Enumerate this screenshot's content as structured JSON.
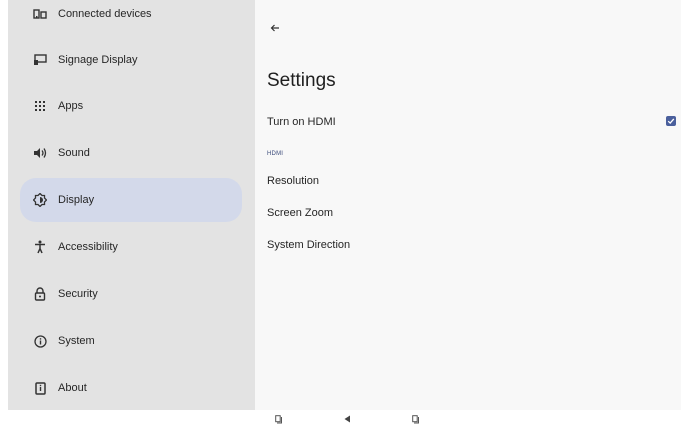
{
  "sidebar": {
    "items": [
      {
        "label": "Connected devices",
        "icon": "connected-devices-icon"
      },
      {
        "label": "Signage Display",
        "icon": "signage-display-icon"
      },
      {
        "label": "Apps",
        "icon": "apps-icon"
      },
      {
        "label": "Sound",
        "icon": "sound-icon"
      },
      {
        "label": "Display",
        "icon": "display-icon",
        "active": true
      },
      {
        "label": "Accessibility",
        "icon": "accessibility-icon"
      },
      {
        "label": "Security",
        "icon": "lock-icon"
      },
      {
        "label": "System",
        "icon": "info-icon"
      },
      {
        "label": "About",
        "icon": "about-icon"
      }
    ]
  },
  "content": {
    "title": "Settings",
    "hdmi_toggle": {
      "label": "Turn on HDMI",
      "checked": true
    },
    "category": "HDMI",
    "prefs": [
      "Resolution",
      "Screen Zoom",
      "System Direction"
    ]
  },
  "colors": {
    "sidebar_bg": "#e3e3e3",
    "active_bg": "#d3d9ea",
    "content_bg": "#f8f8f8",
    "accent": "#4a5f9c"
  }
}
